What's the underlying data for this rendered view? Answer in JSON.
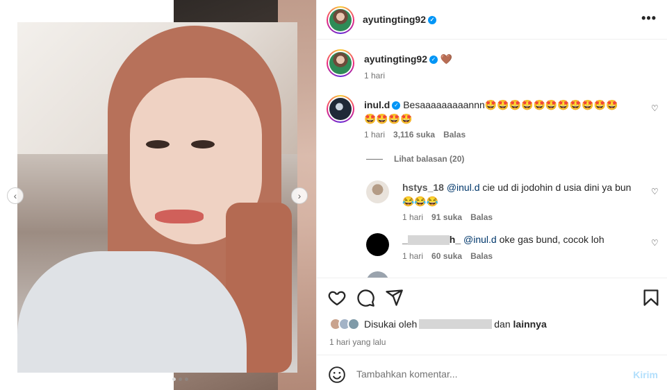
{
  "header": {
    "username": "ayutingting92",
    "more_label": "•••"
  },
  "caption": {
    "username": "ayutingting92",
    "emoji": "🤎",
    "time": "1 hari"
  },
  "comments": [
    {
      "username": "inul.d",
      "text": "Besaaaaaaaaannn🤩🤩🤩🤩🤩🤩🤩🤩🤩🤩🤩🤩🤩🤩🤩",
      "time": "1 hari",
      "likes": "3,116 suka",
      "reply": "Balas",
      "view_replies": "Lihat balasan (20)"
    },
    {
      "username": "hstys_18",
      "mention": "@inul.d",
      "text": "cie ud di jodohin d usia dini ya bun",
      "text2": "😂😂😂",
      "time": "1 hari",
      "likes": "91 suka",
      "reply": "Balas"
    },
    {
      "username_prefix": "_",
      "username_suffix": "h_",
      "mention": "@inul.d",
      "text": "oke gas bund, cocok loh",
      "time": "1 hari",
      "likes": "60 suka",
      "reply": "Balas"
    }
  ],
  "likes": {
    "prefix": "Disukai oleh",
    "connector": "dan",
    "others": "lainnya"
  },
  "post_time": "1 hari yang lalu",
  "add_comment": {
    "placeholder": "Tambahkan komentar...",
    "post_label": "Kirim"
  },
  "icons": [
    "chevron-left-icon",
    "chevron-right-icon",
    "heart-icon",
    "comment-icon",
    "share-icon",
    "bookmark-icon",
    "emoji-icon",
    "verified-icon",
    "more-icon"
  ],
  "colors": {
    "verified": "#0095f6",
    "post_button": "#b2dffc",
    "muted": "#737373",
    "mention": "#00376b"
  }
}
